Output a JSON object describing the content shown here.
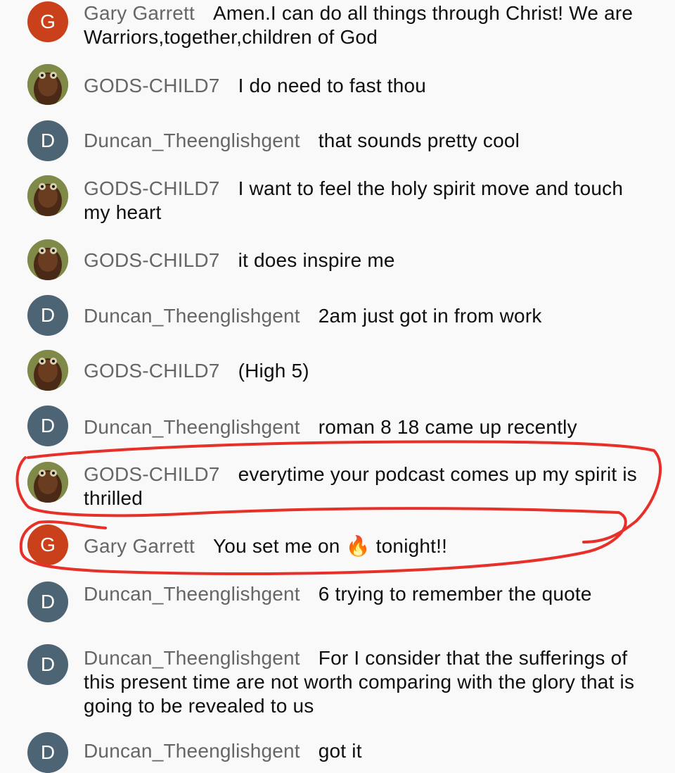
{
  "chat": {
    "messages": [
      {
        "author": "Gary Garrett",
        "text": "Amen.I can do all things through Christ! We are Warriors,together,children of God",
        "avatar": {
          "type": "letter",
          "letter": "G",
          "color": "#c9401a"
        }
      },
      {
        "author": "GODS-CHILD7",
        "text": "I do need to fast thou",
        "avatar": {
          "type": "photo"
        }
      },
      {
        "author": "Duncan_Theenglishgent",
        "text": "that sounds pretty cool",
        "avatar": {
          "type": "letter",
          "letter": "D",
          "color": "#4d6474"
        }
      },
      {
        "author": "GODS-CHILD7",
        "text": "I want to feel the holy spirit move and touch my heart",
        "avatar": {
          "type": "photo"
        }
      },
      {
        "author": "GODS-CHILD7",
        "text": "it does inspire me",
        "avatar": {
          "type": "photo"
        }
      },
      {
        "author": "Duncan_Theenglishgent",
        "text": "2am just got in from work",
        "avatar": {
          "type": "letter",
          "letter": "D",
          "color": "#4d6474"
        }
      },
      {
        "author": "GODS-CHILD7",
        "text": "(High 5)",
        "avatar": {
          "type": "photo"
        }
      },
      {
        "author": "Duncan_Theenglishgent",
        "text": "roman 8 18 came up recently",
        "avatar": {
          "type": "letter",
          "letter": "D",
          "color": "#4d6474"
        }
      },
      {
        "author": "GODS-CHILD7",
        "text": "everytime your podcast comes up my spirit is thrilled",
        "avatar": {
          "type": "photo"
        }
      },
      {
        "author": "Gary Garrett",
        "text_before": "You set me on",
        "emoji": "🔥",
        "text_after": "tonight!!",
        "avatar": {
          "type": "letter",
          "letter": "G",
          "color": "#c9401a"
        }
      },
      {
        "author": "Duncan_Theenglishgent",
        "text": "6 trying to remember the quote",
        "avatar": {
          "type": "letter",
          "letter": "D",
          "color": "#4d6474"
        }
      },
      {
        "author": "Duncan_Theenglishgent",
        "text": "For I consider that the sufferings of this present time are not worth comparing with the glory that is going to be revealed to us",
        "avatar": {
          "type": "letter",
          "letter": "D",
          "color": "#4d6474"
        }
      },
      {
        "author": "Duncan_Theenglishgent",
        "text": "got it",
        "avatar": {
          "type": "letter",
          "letter": "D",
          "color": "#4d6474"
        }
      }
    ]
  },
  "annotation": {
    "color": "#e8302a",
    "icon": "red-hand-drawn-circle"
  }
}
